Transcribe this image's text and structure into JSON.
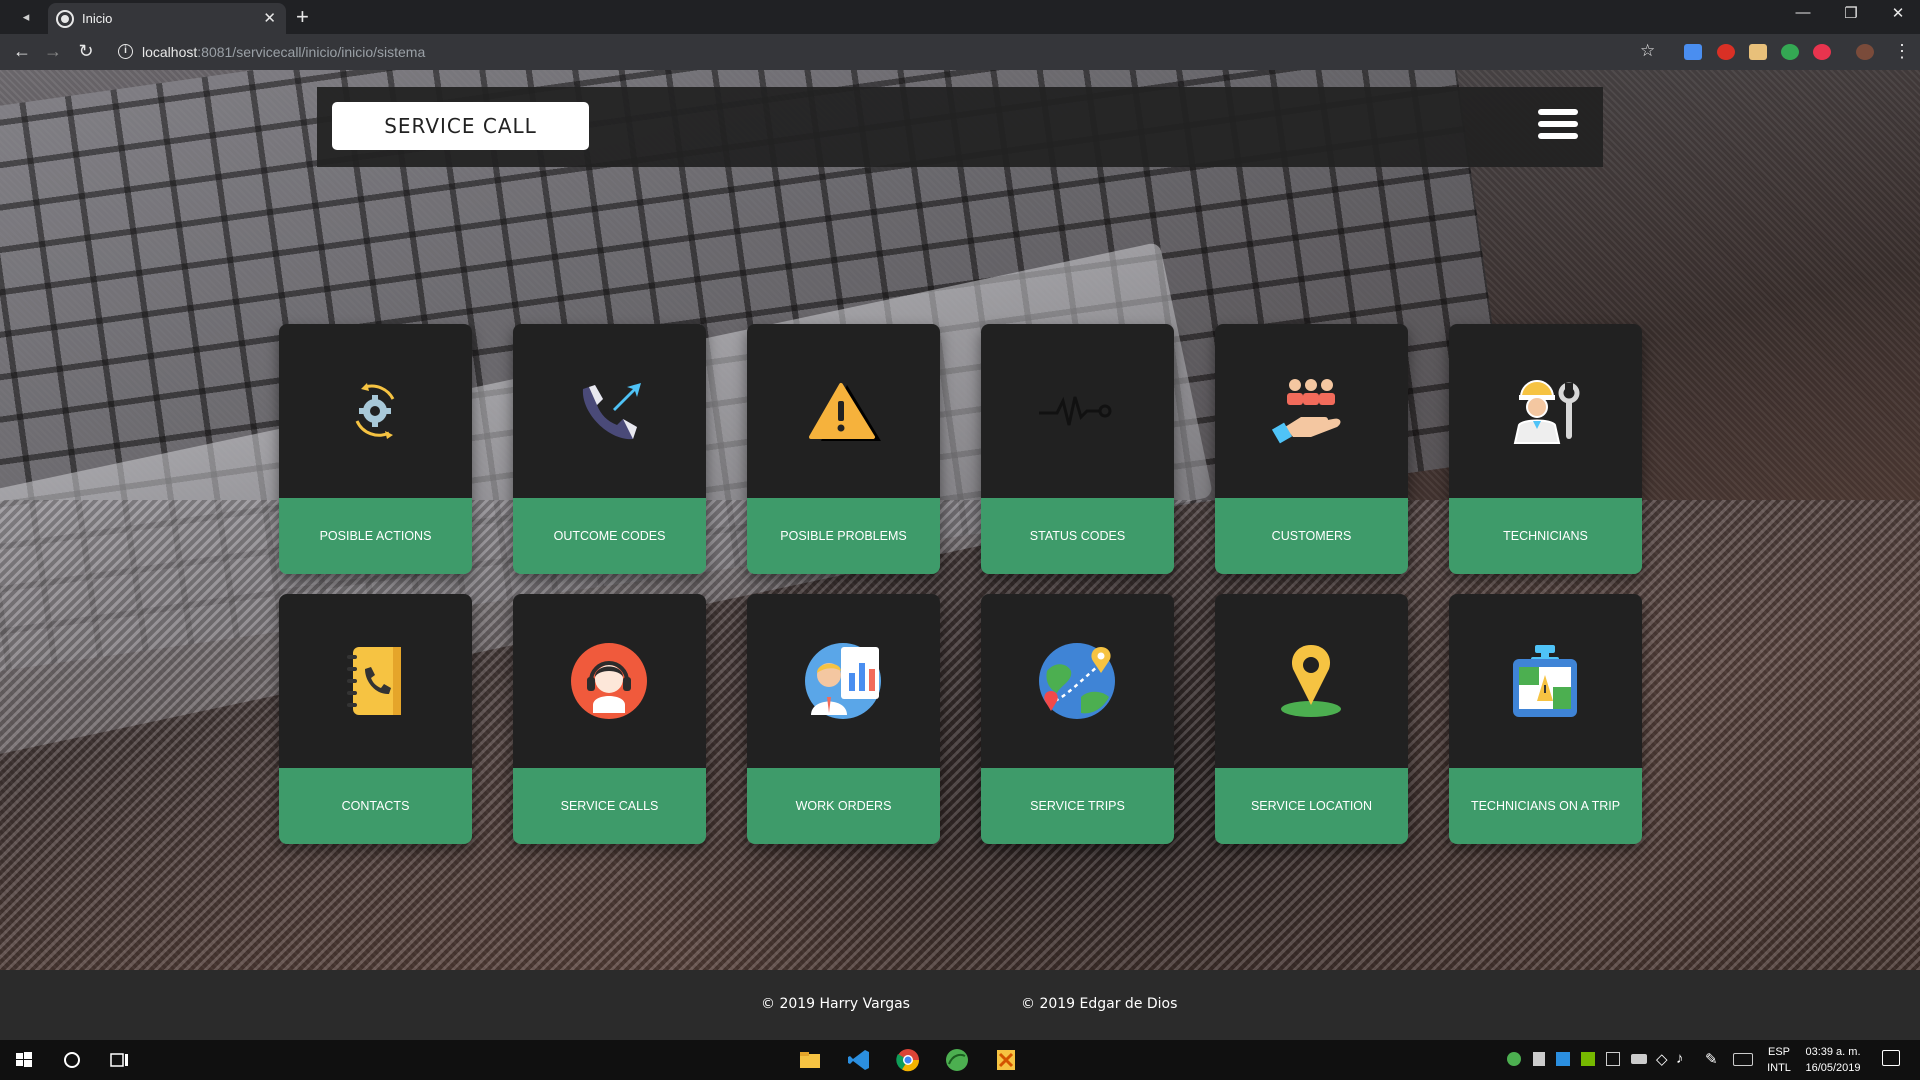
{
  "browser": {
    "tab_title": "Inicio",
    "url_host": "localhost",
    "url_rest": ":8081/servicecall/inicio/inicio/sistema",
    "new_tab_symbol": "+",
    "close_symbol": "✕"
  },
  "header": {
    "brand": "SERVICE CALL"
  },
  "cards": [
    {
      "label": "POSIBLE ACTIONS",
      "icon": "gear-cycle-icon"
    },
    {
      "label": "OUTCOME CODES",
      "icon": "phone-outgoing-icon"
    },
    {
      "label": "POSIBLE PROBLEMS",
      "icon": "warning-icon"
    },
    {
      "label": "STATUS CODES",
      "icon": "heartbeat-icon"
    },
    {
      "label": "CUSTOMERS",
      "icon": "customers-hand-icon"
    },
    {
      "label": "TECHNICIANS",
      "icon": "technician-icon"
    },
    {
      "label": "CONTACTS",
      "icon": "contacts-book-icon"
    },
    {
      "label": "SERVICE CALLS",
      "icon": "headset-agent-icon"
    },
    {
      "label": "WORK ORDERS",
      "icon": "presenter-chart-icon"
    },
    {
      "label": "SERVICE TRIPS",
      "icon": "globe-route-icon"
    },
    {
      "label": "SERVICE LOCATION",
      "icon": "map-pin-icon"
    },
    {
      "label": "TECHNICIANS ON A TRIP",
      "icon": "map-clip-icon"
    }
  ],
  "footer": {
    "credit_1": "© 2019 Harry Vargas",
    "credit_2": "© 2019 Edgar de Dios"
  },
  "taskbar": {
    "lang_1": "ESP",
    "lang_2": "INTL",
    "time": "03:39 a. m.",
    "date": "16/05/2019"
  },
  "colors": {
    "card_accent": "#3e9b6a",
    "card_body": "#212121",
    "header_bg": "#222222"
  }
}
